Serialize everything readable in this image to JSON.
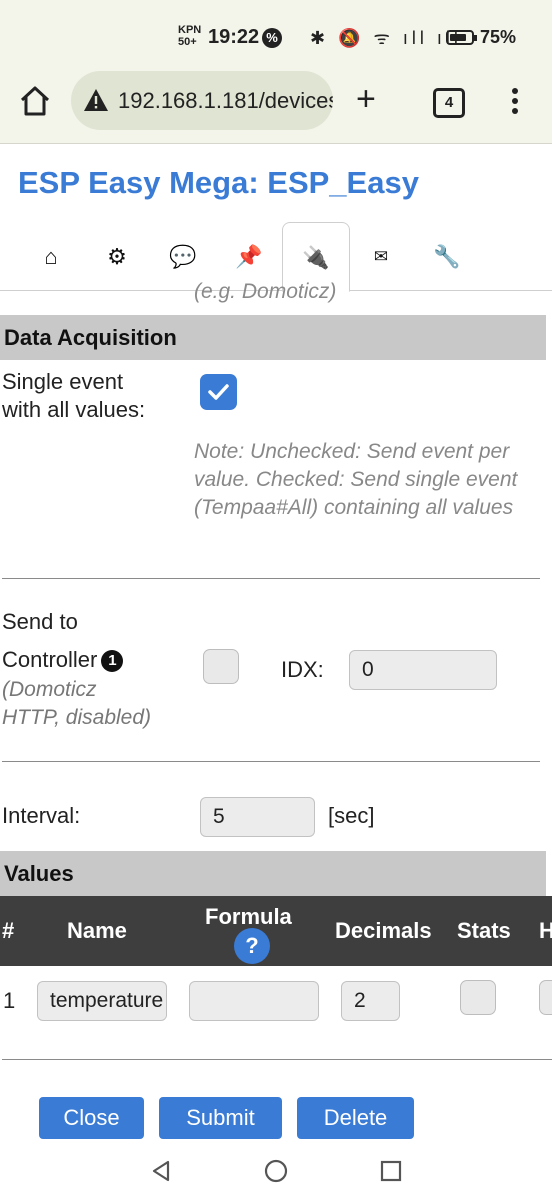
{
  "status_bar": {
    "carrier_top": "KPN",
    "carrier_bottom": "50+",
    "time": "19:22",
    "badge": "%",
    "icons": "✱ 🔕 ᯤ ıll ıll",
    "battery": "75%",
    "battery_level": 0.75
  },
  "browser": {
    "url": "192.168.1.181/devices",
    "tab_count": "4"
  },
  "page": {
    "title": "ESP Easy Mega: ESP_Easy",
    "nav_tabs": [
      {
        "icon": "⌂",
        "name": "home"
      },
      {
        "icon": "⚙",
        "name": "config"
      },
      {
        "icon": "💬",
        "name": "controllers"
      },
      {
        "icon": "📌",
        "name": "hardware"
      },
      {
        "icon": "🔌",
        "name": "devices"
      },
      {
        "icon": "✉",
        "name": "notifications"
      },
      {
        "icon": "🔧",
        "name": "tools"
      }
    ],
    "cut_note": "(e.g. Domoticz)"
  },
  "data_acquisition": {
    "header": "Data Acquisition",
    "single_event_label_1": "Single event",
    "single_event_label_2": "with all values:",
    "single_event_checked": true,
    "note": "Note: Unchecked: Send event per value. Checked: Send single event (Tempaa#All) containing all values",
    "send_to_label_1": "Send to",
    "send_to_label_2": "Controller",
    "info_icon": "1",
    "controller_note_1": "(Domoticz",
    "controller_note_2": "HTTP, disabled)",
    "send_checked": false,
    "idx_label": "IDX:",
    "idx_value": "0",
    "interval_label": "Interval:",
    "interval_value": "5",
    "interval_unit": "[sec]"
  },
  "values": {
    "header": "Values",
    "columns": {
      "number": "#",
      "name": "Name",
      "formula": "Formula",
      "formula_help": "?",
      "decimals": "Decimals",
      "stats": "Stats",
      "hidden": "H"
    },
    "rows": [
      {
        "number": "1",
        "name": "temperature",
        "formula": "",
        "decimals": "2",
        "stats": false
      }
    ]
  },
  "buttons": {
    "close": "Close",
    "submit": "Submit",
    "delete": "Delete"
  },
  "colors": {
    "accent": "#3a7bd5",
    "table_header": "#3e3e3e",
    "section_header": "#c8c8c8"
  }
}
